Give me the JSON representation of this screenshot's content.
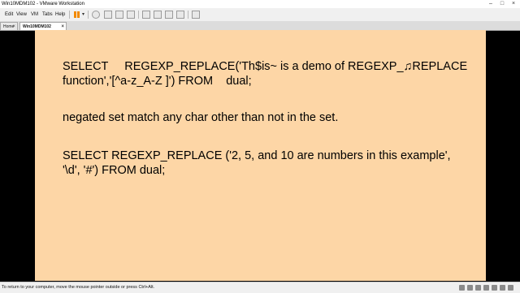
{
  "window": {
    "title": "Win10MDM102 - VMware Workstation"
  },
  "menubar": {
    "items": [
      "Edit",
      "View",
      "VM",
      "Tabs",
      "Help"
    ]
  },
  "tabs": [
    {
      "label": "Home"
    },
    {
      "label": "Win10MDM102",
      "active": true
    }
  ],
  "slide": {
    "background": "#fdd6a6",
    "lines": [
      "SELECT     REGEXP_REPLACE('Th$is~ is a demo of REGEXP_♫REPLACE",
      "function','[^a-z_A-Z ]') FROM    dual;",
      "negated set match any char other than not in the set.",
      "SELECT REGEXP_REPLACE ('2, 5, and 10 are numbers in this example',",
      "'\\d', '#') FROM dual;"
    ]
  },
  "statusbar": {
    "message": "To return to your computer, move the mouse pointer outside or press Ctrl+Alt."
  }
}
